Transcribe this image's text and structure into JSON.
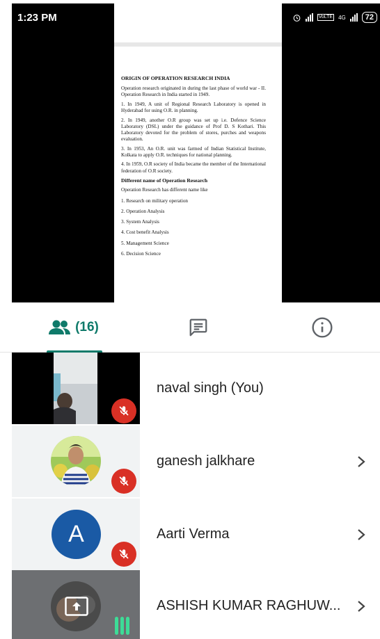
{
  "status": {
    "time": "1:23 PM",
    "lte": "VoLTE",
    "net": "4G",
    "battery": "72"
  },
  "document": {
    "title": "ORIGIN OF OPERATION RESEARCH INDIA",
    "intro": "Operation research originated in during the last phase of world war - II. Operation Research in India started in 1949.",
    "points": [
      "1. In 1949, A unit of Regional Research Laboratory is opened in Hyderabad for using O.R. in planning.",
      "2. In 1949, another O.R group was set up i.e. Defence Science Laboratory (DSL) under the guidance of  Prof D. S Kothari. This Laboratory devoted for the problem of stores, purches and weapons evaluation.",
      "3. In 1953, An O.R. unit was farmed of Indian Statistical Institute, Kolkata to apply O.R. techniques for national planning.",
      "4. In 1959,  O.R society of India became the member of the International federation of O.R society."
    ],
    "subheading": "Different name of Operation Research",
    "subintro": "Operation Research has different name like",
    "names": [
      "1. Research on military operation",
      "2. Operation Analysis",
      "3. System Analysis",
      "4. Cost benefit Analysis",
      "5. Management Science",
      "6. Decision Science"
    ]
  },
  "tabs": {
    "people_count": "(16)"
  },
  "participants": [
    {
      "name": "naval singh (You)"
    },
    {
      "name": "ganesh jalkhare"
    },
    {
      "name": "Aarti Verma",
      "avatar_letter": "A"
    },
    {
      "name": "ASHISH KUMAR RAGHUW..."
    }
  ],
  "colors": {
    "accent": "#0f7a6a",
    "mic_off": "#d93025",
    "avatar_blue": "#1a5aa5",
    "speaking": "#3ddc97"
  }
}
